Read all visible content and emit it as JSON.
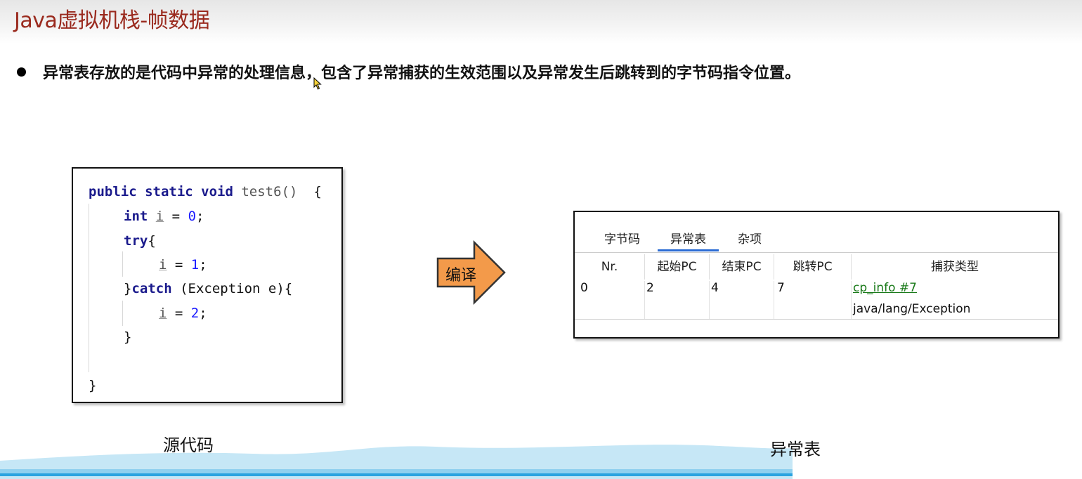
{
  "slide": {
    "title": "Java虚拟机栈-帧数据",
    "bullet": "异常表存放的是代码中异常的处理信息，包含了异常捕获的生效范围以及异常发生后跳转到的字节码指令位置。"
  },
  "code": {
    "line1": {
      "kw": "public static void",
      "fn": "test6()",
      "brace": "  {"
    },
    "line2": {
      "kw": "int",
      "var": "i",
      "rest": " = ",
      "num": "0",
      "end": ";"
    },
    "line3": {
      "kw": "try",
      "end": "{"
    },
    "line4": {
      "var": "i",
      "rest": " = ",
      "num": "1",
      "end": ";"
    },
    "line5": {
      "open": "}",
      "kw": "catch",
      "rest": " (Exception e){"
    },
    "line6": {
      "var": "i",
      "rest": " = ",
      "num": "2",
      "end": ";"
    },
    "line7": "}",
    "line8": "}"
  },
  "arrow": {
    "label": "编译",
    "color": "#f39a4a"
  },
  "panel": {
    "tabs": [
      "字节码",
      "异常表",
      "杂项"
    ],
    "active_tab": 1,
    "columns": [
      "Nr.",
      "起始PC",
      "结束PC",
      "跳转PC",
      "捕获类型"
    ],
    "row": {
      "nr": "0",
      "start_pc": "2",
      "end_pc": "4",
      "handler_pc": "7",
      "catch_link": "cp_info #7",
      "catch_type": "java/lang/Exception"
    }
  },
  "captions": {
    "source": "源代码",
    "table": "异常表"
  },
  "colors": {
    "title": "#9a2a1e",
    "tab_underline": "#2b6cd4",
    "link": "#1a7a1a",
    "wave": "#bfe3f5"
  }
}
